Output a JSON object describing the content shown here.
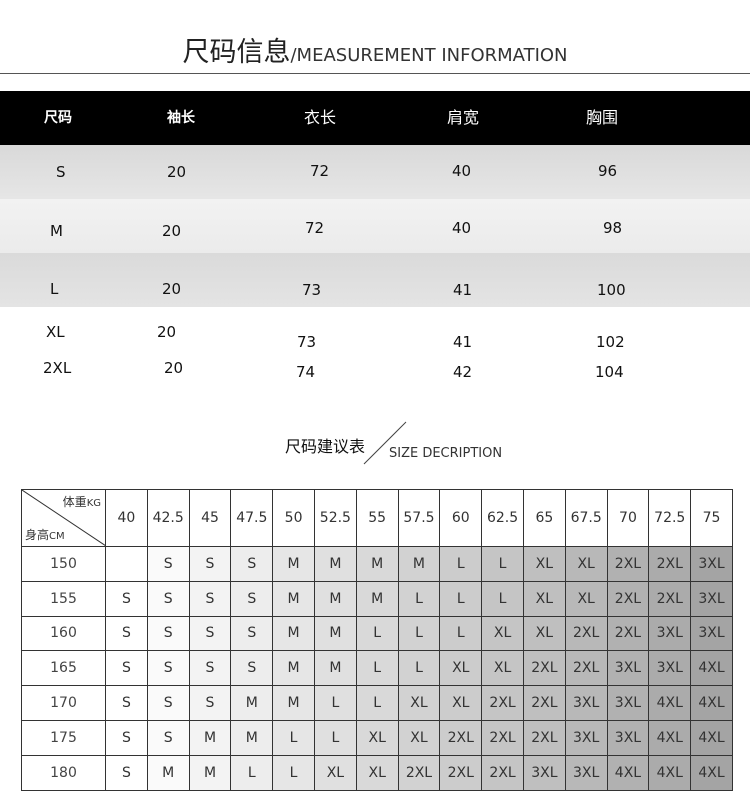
{
  "title": {
    "cn": "尺码信息",
    "en": "/MEASUREMENT INFORMATION"
  },
  "measure": {
    "headers": [
      "尺码",
      "袖长",
      "衣长",
      "肩宽",
      "胸围"
    ],
    "rows": [
      {
        "size": "S",
        "sleeve": "20",
        "length": "72",
        "shoulder": "40",
        "chest": "96"
      },
      {
        "size": "M",
        "sleeve": "20",
        "length": "72",
        "shoulder": "40",
        "chest": "98"
      },
      {
        "size": "L",
        "sleeve": "20",
        "length": "73",
        "shoulder": "41",
        "chest": "100"
      },
      {
        "size": "XL",
        "sleeve": "20",
        "length": "73",
        "shoulder": "41",
        "chest": "102"
      },
      {
        "size": "2XL",
        "sleeve": "20",
        "length": "74",
        "shoulder": "42",
        "chest": "104"
      }
    ]
  },
  "subtitle": {
    "cn": "尺码建议表",
    "en": "SIZE DECRIPTION"
  },
  "grid": {
    "corner": {
      "weight": "体重",
      "weight_unit": "KG",
      "height": "身高",
      "height_unit": "CM"
    },
    "weights": [
      "40",
      "42.5",
      "45",
      "47.5",
      "50",
      "52.5",
      "55",
      "57.5",
      "60",
      "62.5",
      "65",
      "67.5",
      "70",
      "72.5",
      "75"
    ],
    "rows": [
      {
        "height": "150",
        "cells": [
          "",
          "S",
          "S",
          "S",
          "M",
          "M",
          "M",
          "M",
          "L",
          "L",
          "XL",
          "XL",
          "2XL",
          "2XL",
          "3XL"
        ]
      },
      {
        "height": "155",
        "cells": [
          "S",
          "S",
          "S",
          "S",
          "M",
          "M",
          "M",
          "L",
          "L",
          "L",
          "XL",
          "XL",
          "2XL",
          "2XL",
          "3XL"
        ]
      },
      {
        "height": "160",
        "cells": [
          "S",
          "S",
          "S",
          "S",
          "M",
          "M",
          "L",
          "L",
          "L",
          "XL",
          "XL",
          "2XL",
          "2XL",
          "3XL",
          "3XL"
        ]
      },
      {
        "height": "165",
        "cells": [
          "S",
          "S",
          "S",
          "S",
          "M",
          "M",
          "L",
          "L",
          "XL",
          "XL",
          "2XL",
          "2XL",
          "3XL",
          "3XL",
          "4XL"
        ]
      },
      {
        "height": "170",
        "cells": [
          "S",
          "S",
          "S",
          "M",
          "M",
          "L",
          "L",
          "XL",
          "XL",
          "2XL",
          "2XL",
          "3XL",
          "3XL",
          "4XL",
          "4XL"
        ]
      },
      {
        "height": "175",
        "cells": [
          "S",
          "S",
          "M",
          "M",
          "L",
          "L",
          "XL",
          "XL",
          "2XL",
          "2XL",
          "2XL",
          "3XL",
          "3XL",
          "4XL",
          "4XL"
        ]
      },
      {
        "height": "180",
        "cells": [
          "S",
          "M",
          "M",
          "L",
          "L",
          "XL",
          "XL",
          "2XL",
          "2XL",
          "2XL",
          "3XL",
          "3XL",
          "4XL",
          "4XL",
          "4XL"
        ]
      }
    ]
  },
  "colors": {
    "header_bg": "#000000",
    "row_gray_dark": "#dcdcdc",
    "row_gray_light": "#efefef"
  }
}
